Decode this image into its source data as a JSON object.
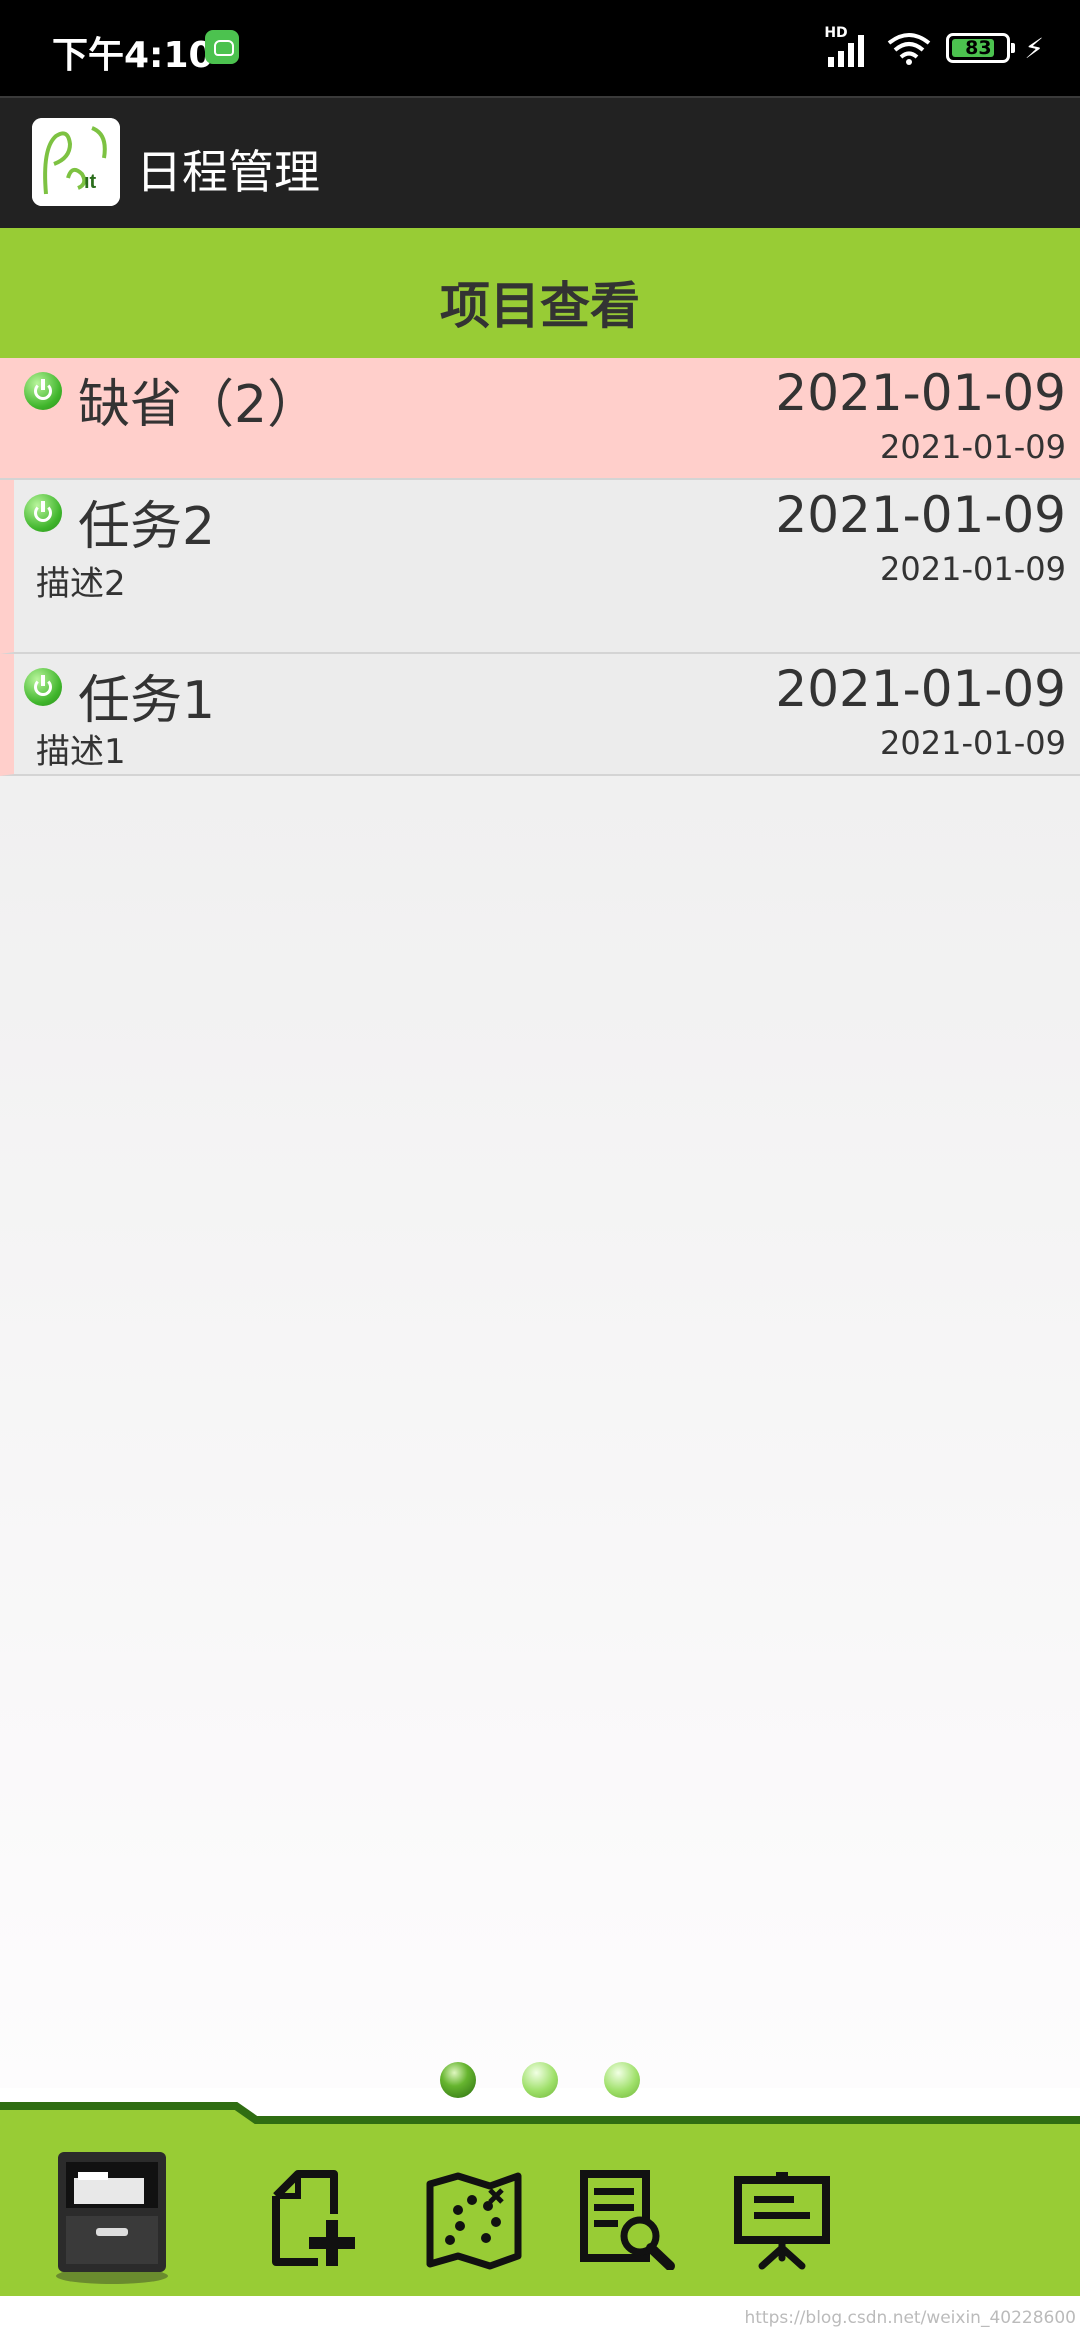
{
  "status_bar": {
    "time": "下午4:10",
    "network_label": "HD",
    "battery_level": "83",
    "icons": [
      "app-notification-icon",
      "signal-icon",
      "wifi-icon",
      "battery-icon",
      "charging-icon"
    ]
  },
  "app_bar": {
    "title": "日程管理",
    "logo_icon": "app-logo-icon"
  },
  "section": {
    "title": "项目查看"
  },
  "list": {
    "items": [
      {
        "name": "缺省（2）",
        "desc": "",
        "date": "2021-01-09",
        "sub_date": "2021-01-09",
        "type": "default"
      },
      {
        "name": "任务2",
        "desc": "描述2",
        "date": "2021-01-09",
        "sub_date": "2021-01-09",
        "type": "task"
      },
      {
        "name": "任务1",
        "desc": "描述1",
        "date": "2021-01-09",
        "sub_date": "2021-01-09",
        "type": "task"
      }
    ]
  },
  "pager": {
    "count": 3,
    "active_index": 0
  },
  "bottom_nav": {
    "items": [
      "cabinet-icon",
      "add-document-icon",
      "map-icon",
      "search-document-icon",
      "presentation-icon"
    ],
    "active_index": 0
  },
  "colors": {
    "accent_green": "#98cc35",
    "dark_green": "#2f6d12",
    "default_row": "#ffcfcb",
    "app_bar": "#222222"
  },
  "watermark": "https://blog.csdn.net/weixin_40228600"
}
